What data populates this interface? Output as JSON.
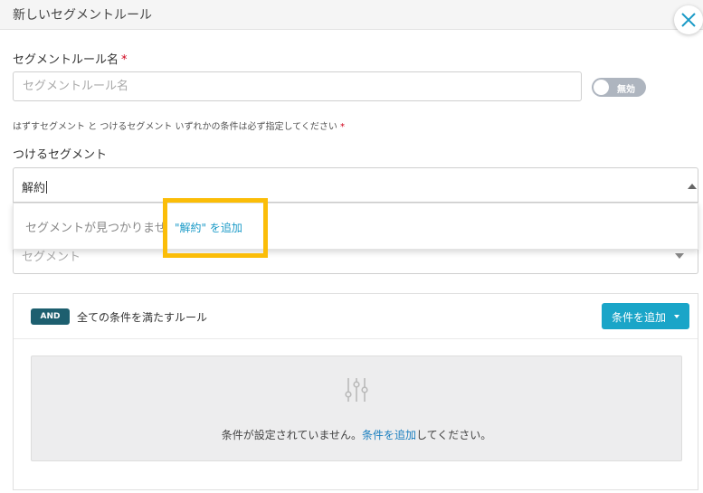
{
  "header": {
    "title": "新しいセグメントルール"
  },
  "form": {
    "name_label": "セグメントルール名",
    "required_mark": "*",
    "name_placeholder": "セグメントルール名",
    "toggle_label": "無効",
    "hint": "はずすセグメント と つけるセグメント いずれかの条件は必ず指定してください",
    "attach_label": "つけるセグメント",
    "attach_value": "解約",
    "dropdown_empty": "セグメントが見つかりません",
    "dropdown_add": "\"解約\" を追加",
    "remove_placeholder": "セグメント"
  },
  "rules": {
    "badge": "AND",
    "title": "全ての条件を満たすルール",
    "add_button": "条件を追加",
    "empty_prefix": "条件が設定されていません。",
    "empty_link": "条件を追加",
    "empty_suffix": "してください。"
  },
  "colors": {
    "accent": "#1aa5c8",
    "badge": "#1d5f6f",
    "highlight": "#fbbd08",
    "required": "#d0021b"
  },
  "icons": [
    "close-icon",
    "chevron-up-icon",
    "chevron-down-icon",
    "sliders-icon"
  ]
}
